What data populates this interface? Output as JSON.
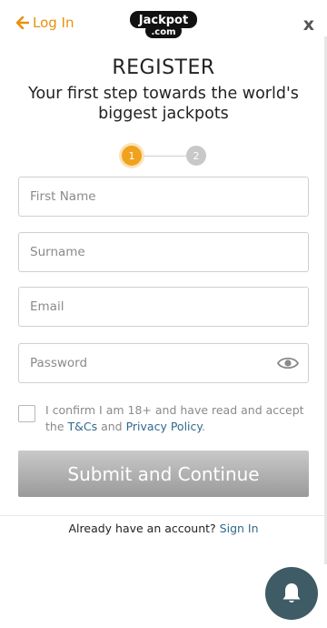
{
  "header": {
    "back_label": "Log In",
    "logo_text_top": "Jackpot",
    "logo_text_bottom": ".com",
    "close_label": "x"
  },
  "title": "REGISTER",
  "subtitle": "Your first step towards the world's biggest jackpots",
  "steps": [
    "1",
    "2"
  ],
  "current_step": 1,
  "fields": {
    "first_name_placeholder": "First Name",
    "surname_placeholder": "Surname",
    "email_placeholder": "Email",
    "password_placeholder": "Password"
  },
  "confirm": {
    "text_before": "I confirm I am 18+ and have read and accept the ",
    "terms_link": "T&Cs",
    "text_middle": " and ",
    "privacy_link": "Privacy Policy",
    "text_after": "."
  },
  "submit_label": "Submit and Continue",
  "signin": {
    "prompt": "Already have an account?",
    "link": "Sign In"
  },
  "icons": {
    "back": "arrow-left-icon",
    "eye": "eye-icon",
    "bell": "bell-icon"
  },
  "colors": {
    "accent": "#e8910c",
    "step_active": "#f0a21e",
    "link": "#2e6a8d",
    "bell_bg": "#3f5b66"
  }
}
